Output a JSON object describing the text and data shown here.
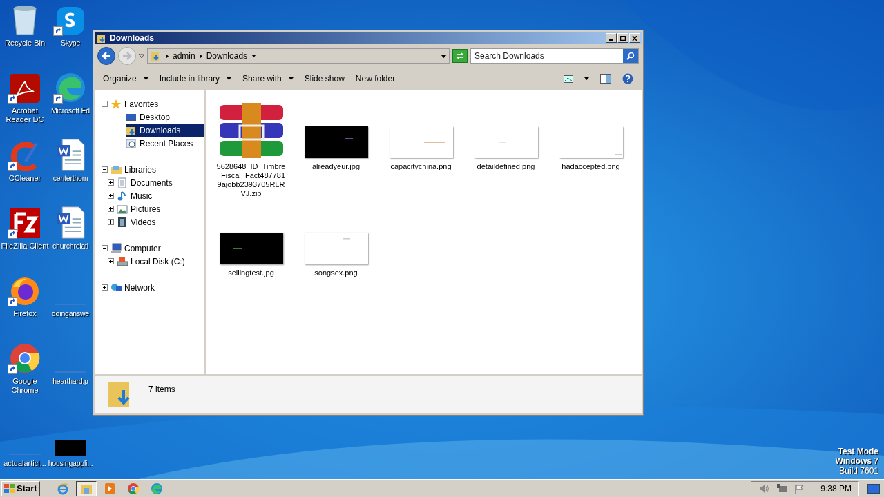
{
  "desktop": {
    "icons": [
      {
        "label": "Recycle Bin",
        "kind": "bin",
        "shortcut": false
      },
      {
        "label": "Skype",
        "kind": "skype",
        "shortcut": true
      },
      {
        "label": "Acrobat Reader DC",
        "kind": "acrobat",
        "shortcut": true
      },
      {
        "label": "Microsoft Ed",
        "kind": "edge",
        "shortcut": true
      },
      {
        "label": "CCleaner",
        "kind": "ccleaner",
        "shortcut": true
      },
      {
        "label": "centerthom",
        "kind": "word",
        "shortcut": false
      },
      {
        "label": "FileZilla Client",
        "kind": "filezilla",
        "shortcut": true
      },
      {
        "label": "churchrelati",
        "kind": "word",
        "shortcut": false
      },
      {
        "label": "Firefox",
        "kind": "firefox",
        "shortcut": true
      },
      {
        "label": "doinganswe",
        "kind": "blank",
        "shortcut": false
      },
      {
        "label": "Google Chrome",
        "kind": "chrome",
        "shortcut": true
      },
      {
        "label": "hearthard.p",
        "kind": "blank",
        "shortcut": false
      },
      {
        "label": "actualarticl...",
        "kind": "blank",
        "shortcut": false
      },
      {
        "label": "housingappli...",
        "kind": "dark",
        "shortcut": false
      }
    ],
    "watermark": [
      "Test Mode",
      "Windows 7",
      "Build 7601"
    ]
  },
  "window": {
    "title": "Downloads",
    "address": [
      "admin",
      "Downloads"
    ],
    "search": {
      "placeholder": "Search Downloads"
    },
    "toolbar": [
      {
        "label": "Organize",
        "dropdown": true
      },
      {
        "label": "Include in library",
        "dropdown": true
      },
      {
        "label": "Share with",
        "dropdown": true
      },
      {
        "label": "Slide show",
        "dropdown": false
      },
      {
        "label": "New folder",
        "dropdown": false
      }
    ],
    "nav": [
      {
        "label": "Favorites",
        "kind": "star",
        "expanded": true,
        "selected": false,
        "children": [
          {
            "label": "Desktop",
            "kind": "desktop",
            "selected": false
          },
          {
            "label": "Downloads",
            "kind": "downloads",
            "selected": true
          },
          {
            "label": "Recent Places",
            "kind": "recent",
            "selected": false
          }
        ]
      },
      {
        "label": "Libraries",
        "kind": "library",
        "expanded": true,
        "selected": false,
        "children": [
          {
            "label": "Documents",
            "kind": "documents",
            "expanded": false,
            "selected": false
          },
          {
            "label": "Music",
            "kind": "music",
            "expanded": false,
            "selected": false
          },
          {
            "label": "Pictures",
            "kind": "pictures",
            "expanded": false,
            "selected": false
          },
          {
            "label": "Videos",
            "kind": "videos",
            "expanded": false,
            "selected": false
          }
        ]
      },
      {
        "label": "Computer",
        "kind": "computer",
        "expanded": true,
        "selected": false,
        "children": [
          {
            "label": "Local Disk (C:)",
            "kind": "disk",
            "expanded": false,
            "selected": false
          }
        ]
      },
      {
        "label": "Network",
        "kind": "network",
        "expanded": false,
        "selected": false
      }
    ],
    "files": [
      {
        "name": "5628648_ID_Timbre_Fiscal_Fact4877819ajobb2393705RLRVJ.zip",
        "kind": "archive"
      },
      {
        "name": "alreadyeur.jpg",
        "kind": "dark"
      },
      {
        "name": "capacitychina.png",
        "kind": "light"
      },
      {
        "name": "detaildefined.png",
        "kind": "light"
      },
      {
        "name": "hadaccepted.png",
        "kind": "light"
      },
      {
        "name": "sellingtest.jpg",
        "kind": "dark"
      },
      {
        "name": "songsex.png",
        "kind": "light"
      }
    ],
    "status": "7 items"
  },
  "taskbar": {
    "start": "Start",
    "apps": [
      {
        "kind": "ie",
        "active": false
      },
      {
        "kind": "explorer",
        "active": true
      },
      {
        "kind": "media",
        "active": false
      },
      {
        "kind": "chrome",
        "active": false
      },
      {
        "kind": "edge",
        "active": false
      }
    ],
    "clock": "9:38 PM"
  }
}
